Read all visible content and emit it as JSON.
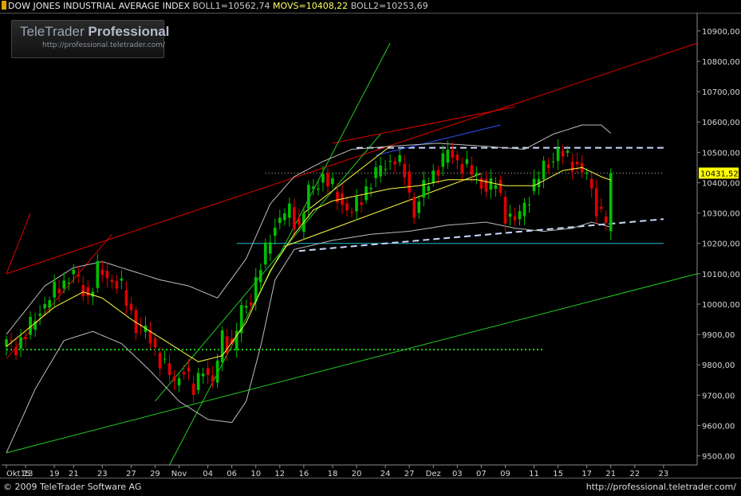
{
  "header": {
    "title": "DOW JONES INDUSTRIAL AVERAGE INDEX",
    "boll1": "BOLL1=10562,74",
    "movs": "MOVS=10408,22",
    "boll2": "BOLL2=10253,69"
  },
  "logo": {
    "brand_prefix": "TeleTrader",
    "brand_bold": "Professional",
    "subtitle": "http://professional.teletrader.com/"
  },
  "footer": {
    "copyright": "© 2009 TeleTrader Software AG",
    "url": "http://professional.teletrader.com/"
  },
  "colors": {
    "background": "#000000",
    "bull_candle": "#00c000",
    "bear_candle": "#e00000",
    "moving_average": "#ffff40",
    "bollinger": "#bdbdbd",
    "trend_red": "#e00000",
    "trend_green": "#22cc22",
    "support_white": "#ccd8ff",
    "line_cyan": "#20c0d0",
    "line_blue": "#3050ff",
    "dotted_green": "#22dd22",
    "price_tag": "#ffff00"
  },
  "chart_data": {
    "type": "candlestick",
    "instrument": "DOW JONES INDUSTRIAL AVERAGE INDEX",
    "last_price_label": "10431,52",
    "last_price": 10431.52,
    "ylim": [
      9470,
      10960
    ],
    "y_ticks": [
      9500,
      9600,
      9700,
      9800,
      9900,
      10000,
      10100,
      10200,
      10300,
      10400,
      10500,
      10600,
      10700,
      10800,
      10900
    ],
    "y_tick_labels": [
      "9500,00",
      "9600,00",
      "9700,00",
      "9800,00",
      "9900,00",
      "10000,00",
      "10100,00",
      "10200,00",
      "10300,00",
      "10400,00",
      "10500,00",
      "10600,00",
      "10700,00",
      "10800,00",
      "10900,00"
    ],
    "grid": false,
    "x_range_index": [
      -1,
      144
    ],
    "x_ticks": [
      {
        "i": 0,
        "label": "Okt 13"
      },
      {
        "i": 4,
        "label": "15"
      },
      {
        "i": 10,
        "label": "19"
      },
      {
        "i": 14,
        "label": "21"
      },
      {
        "i": 20,
        "label": "23"
      },
      {
        "i": 26,
        "label": "27"
      },
      {
        "i": 31,
        "label": "29"
      },
      {
        "i": 36,
        "label": "Nov"
      },
      {
        "i": 42,
        "label": "04"
      },
      {
        "i": 47,
        "label": "06"
      },
      {
        "i": 52,
        "label": "10"
      },
      {
        "i": 57,
        "label": "12"
      },
      {
        "i": 62,
        "label": "16"
      },
      {
        "i": 68,
        "label": "18"
      },
      {
        "i": 73,
        "label": "20"
      },
      {
        "i": 79,
        "label": "24"
      },
      {
        "i": 84,
        "label": "27"
      },
      {
        "i": 89,
        "label": "Dez"
      },
      {
        "i": 94,
        "label": "03"
      },
      {
        "i": 99,
        "label": "07"
      },
      {
        "i": 104,
        "label": "09"
      },
      {
        "i": 110,
        "label": "11"
      },
      {
        "i": 115,
        "label": "15"
      },
      {
        "i": 121,
        "label": "17"
      },
      {
        "i": 126,
        "label": "21"
      },
      {
        "i": 131,
        "label": "22"
      },
      {
        "i": 137,
        "label": "23"
      }
    ],
    "close_path": [
      [
        0,
        9870
      ],
      [
        2,
        9860
      ],
      [
        4,
        9900
      ],
      [
        7,
        9980
      ],
      [
        11,
        10060
      ],
      [
        14,
        10100
      ],
      [
        17,
        10020
      ],
      [
        19,
        10110
      ],
      [
        22,
        10080
      ],
      [
        24,
        10050
      ],
      [
        27,
        9930
      ],
      [
        29,
        9910
      ],
      [
        32,
        9820
      ],
      [
        35,
        9740
      ],
      [
        37,
        9790
      ],
      [
        39,
        9710
      ],
      [
        41,
        9800
      ],
      [
        43,
        9730
      ],
      [
        45,
        9900
      ],
      [
        47,
        9850
      ],
      [
        49,
        9980
      ],
      [
        51,
        10020
      ],
      [
        53,
        10120
      ],
      [
        55,
        10230
      ],
      [
        57,
        10280
      ],
      [
        59,
        10310
      ],
      [
        61,
        10250
      ],
      [
        63,
        10370
      ],
      [
        66,
        10420
      ],
      [
        68,
        10380
      ],
      [
        70,
        10330
      ],
      [
        72,
        10300
      ],
      [
        75,
        10380
      ],
      [
        78,
        10450
      ],
      [
        81,
        10480
      ],
      [
        83,
        10430
      ],
      [
        85,
        10300
      ],
      [
        87,
        10380
      ],
      [
        89,
        10430
      ],
      [
        92,
        10500
      ],
      [
        95,
        10460
      ],
      [
        98,
        10420
      ],
      [
        100,
        10380
      ],
      [
        102,
        10400
      ],
      [
        104,
        10300
      ],
      [
        106,
        10270
      ],
      [
        109,
        10360
      ],
      [
        112,
        10450
      ],
      [
        115,
        10500
      ],
      [
        118,
        10470
      ],
      [
        121,
        10420
      ],
      [
        123,
        10320
      ],
      [
        125,
        10280
      ],
      [
        126,
        10431.52
      ]
    ],
    "moving_average": [
      [
        0,
        9860
      ],
      [
        10,
        9990
      ],
      [
        16,
        10040
      ],
      [
        20,
        10020
      ],
      [
        26,
        9950
      ],
      [
        33,
        9880
      ],
      [
        40,
        9810
      ],
      [
        45,
        9830
      ],
      [
        50,
        9940
      ],
      [
        55,
        10110
      ],
      [
        60,
        10230
      ],
      [
        64,
        10310
      ],
      [
        68,
        10340
      ],
      [
        74,
        10360
      ],
      [
        80,
        10380
      ],
      [
        86,
        10390
      ],
      [
        92,
        10410
      ],
      [
        98,
        10410
      ],
      [
        104,
        10390
      ],
      [
        110,
        10390
      ],
      [
        116,
        10440
      ],
      [
        120,
        10450
      ],
      [
        124,
        10420
      ],
      [
        126,
        10408.22
      ]
    ],
    "bollinger_upper": [
      [
        0,
        9900
      ],
      [
        8,
        10060
      ],
      [
        14,
        10120
      ],
      [
        20,
        10140
      ],
      [
        26,
        10110
      ],
      [
        32,
        10080
      ],
      [
        38,
        10060
      ],
      [
        44,
        10020
      ],
      [
        50,
        10150
      ],
      [
        55,
        10330
      ],
      [
        60,
        10420
      ],
      [
        66,
        10470
      ],
      [
        72,
        10510
      ],
      [
        80,
        10520
      ],
      [
        90,
        10530
      ],
      [
        100,
        10520
      ],
      [
        108,
        10510
      ],
      [
        114,
        10560
      ],
      [
        120,
        10590
      ],
      [
        124,
        10590
      ],
      [
        126,
        10562.74
      ]
    ],
    "bollinger_lower": [
      [
        0,
        9510
      ],
      [
        6,
        9720
      ],
      [
        12,
        9880
      ],
      [
        18,
        9910
      ],
      [
        24,
        9870
      ],
      [
        30,
        9780
      ],
      [
        36,
        9680
      ],
      [
        42,
        9620
      ],
      [
        47,
        9610
      ],
      [
        50,
        9680
      ],
      [
        53,
        9860
      ],
      [
        56,
        10080
      ],
      [
        60,
        10180
      ],
      [
        68,
        10210
      ],
      [
        76,
        10230
      ],
      [
        84,
        10240
      ],
      [
        92,
        10260
      ],
      [
        100,
        10270
      ],
      [
        106,
        10250
      ],
      [
        112,
        10240
      ],
      [
        118,
        10250
      ],
      [
        122,
        10270
      ],
      [
        126,
        10253.69
      ]
    ],
    "trend_lines": [
      {
        "name": "red-upper-channel",
        "color": "red",
        "from": [
          0,
          10100
        ],
        "to": [
          144,
          10860
        ]
      },
      {
        "name": "red-steep-short",
        "color": "red",
        "from": [
          0,
          10100
        ],
        "to": [
          5,
          10300
        ]
      },
      {
        "name": "red-short-2",
        "color": "red",
        "from": [
          0,
          9820
        ],
        "to": [
          22,
          10230
        ]
      },
      {
        "name": "red-upper-short",
        "color": "red",
        "from": [
          68,
          10530
        ],
        "to": [
          106,
          10650
        ]
      },
      {
        "name": "green-long-support",
        "color": "green",
        "from": [
          0,
          9510
        ],
        "to": [
          144,
          10100
        ]
      },
      {
        "name": "green-steep-1",
        "color": "green",
        "from": [
          34,
          9470
        ],
        "to": [
          80,
          10860
        ]
      },
      {
        "name": "green-steep-2",
        "color": "green",
        "from": [
          31,
          9680
        ],
        "to": [
          78,
          10560
        ]
      },
      {
        "name": "blue-short",
        "color": "blue",
        "from": [
          77,
          10490
        ],
        "to": [
          103,
          10590
        ]
      },
      {
        "name": "yellow-channel-low",
        "color": "yellow",
        "from": [
          58,
          10190
        ],
        "to": [
          99,
          10430
        ]
      },
      {
        "name": "yellow-channel-high",
        "color": "yellow",
        "from": [
          62,
          10300
        ],
        "to": [
          80,
          10520
        ]
      }
    ],
    "horizontal_lines": [
      {
        "name": "resistance-dashed",
        "style": "dashed",
        "color": "white",
        "y": 10515,
        "x_from": 73,
        "x_to": 137
      },
      {
        "name": "cyan-level",
        "style": "solid",
        "color": "cyan",
        "y": 10200,
        "x_from": 48,
        "x_to": 137
      },
      {
        "name": "green-dotted-level",
        "style": "dotted",
        "color": "green",
        "y": 9850,
        "x_from": 0,
        "x_to": 112
      },
      {
        "name": "last-price-dotted",
        "style": "dotted",
        "color": "grey",
        "y": 10431.52,
        "x_from": 54,
        "x_to": 137
      }
    ],
    "support_dashed": {
      "style": "dashed",
      "color": "white",
      "from": [
        61,
        10175
      ],
      "to": [
        137,
        10280
      ]
    }
  }
}
